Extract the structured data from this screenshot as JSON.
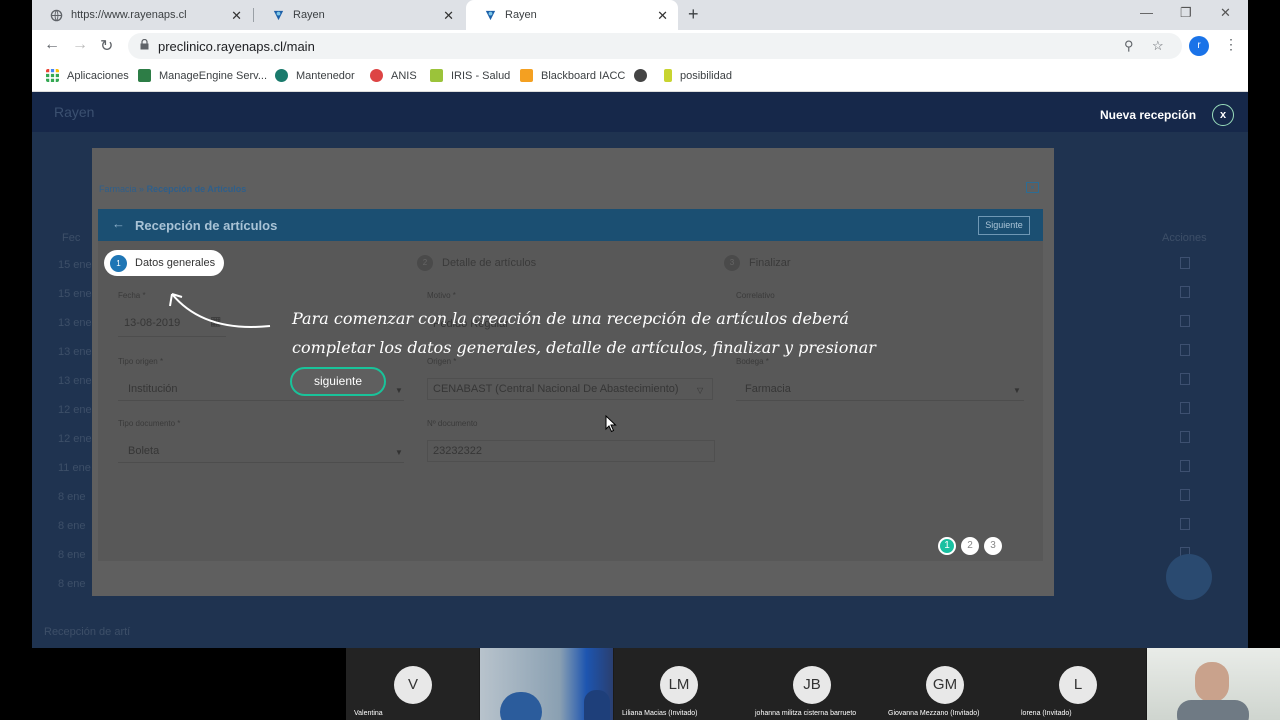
{
  "browser": {
    "tabs": [
      {
        "title": "https://www.rayenaps.cl"
      },
      {
        "title": "Rayen"
      },
      {
        "title": "Rayen"
      }
    ],
    "url": "preclinico.rayenaps.cl/main",
    "profile_initial": "r",
    "bookmarks": [
      "Aplicaciones",
      "ManageEngine Serv...",
      "Mantenedor",
      "ANIS",
      "IRIS - Salud",
      "Blackboard IACC",
      "posibilidad"
    ]
  },
  "app": {
    "brand": "Rayen",
    "nueva_recepcion": "Nueva recepción",
    "close_label": "x",
    "bg_column_left": "Fec",
    "bg_column_right": "Acciones",
    "bg_dates": [
      "15 ene",
      "15 ene",
      "13 ene",
      "13 ene",
      "13 ene",
      "12 ene",
      "12 ene",
      "11 ene",
      "8 ene",
      "8 ene",
      "8 ene",
      "8 ene"
    ],
    "bg_footer": "Recepción de artí"
  },
  "modal": {
    "breadcrumb_parent": "Farmacia",
    "breadcrumb_sep": "»",
    "breadcrumb_current": "Recepción de Artículos",
    "panel_title": "Recepción de artículos",
    "next_button": "Siguiente",
    "steps": [
      {
        "num": "1",
        "label": "Datos generales"
      },
      {
        "num": "2",
        "label": "Detalle de artículos"
      },
      {
        "num": "3",
        "label": "Finalizar"
      }
    ],
    "fields": {
      "fecha_label": "Fecha *",
      "fecha_value": "13-08-2019",
      "motivo_label": "Motivo *",
      "motivo_value": "Pedido Regular",
      "correlativo_label": "Correlativo",
      "tipo_origen_label": "Tipo origen *",
      "tipo_origen_value": "Institución",
      "origen_label": "Origen *",
      "origen_value": "CENABAST (Central Nacional De Abastecimiento)",
      "bodega_label": "Bodega *",
      "bodega_value": "Farmacia",
      "tipo_doc_label": "Tipo documento *",
      "tipo_doc_value": "Boleta",
      "n_doc_label": "Nº documento",
      "n_doc_value": "23232322"
    }
  },
  "tutorial": {
    "text": "Para comenzar con la creación de una recepción de artículos deberá completar los datos generales, detalle de artículos, finalizar y presionar siguiente.",
    "button": "siguiente",
    "pages": [
      "1",
      "2",
      "3"
    ],
    "current_page": 1
  },
  "meeting": {
    "participants": [
      {
        "initials": "V",
        "name": "Valentina"
      },
      {
        "initials": "",
        "name": ""
      },
      {
        "initials": "LM",
        "name": "Liliana Macias (Invitado)"
      },
      {
        "initials": "JB",
        "name": "johanna militza cisterna barrueto"
      },
      {
        "initials": "GM",
        "name": "Giovanna Mezzano (Invitado)"
      },
      {
        "initials": "L",
        "name": "lorena (Invitado)"
      },
      {
        "initials": "",
        "name": ""
      }
    ]
  },
  "colors": {
    "panel_header": "#1b4f72",
    "tutorial_accent": "#19c39a",
    "step_active": "#1f76b5"
  }
}
